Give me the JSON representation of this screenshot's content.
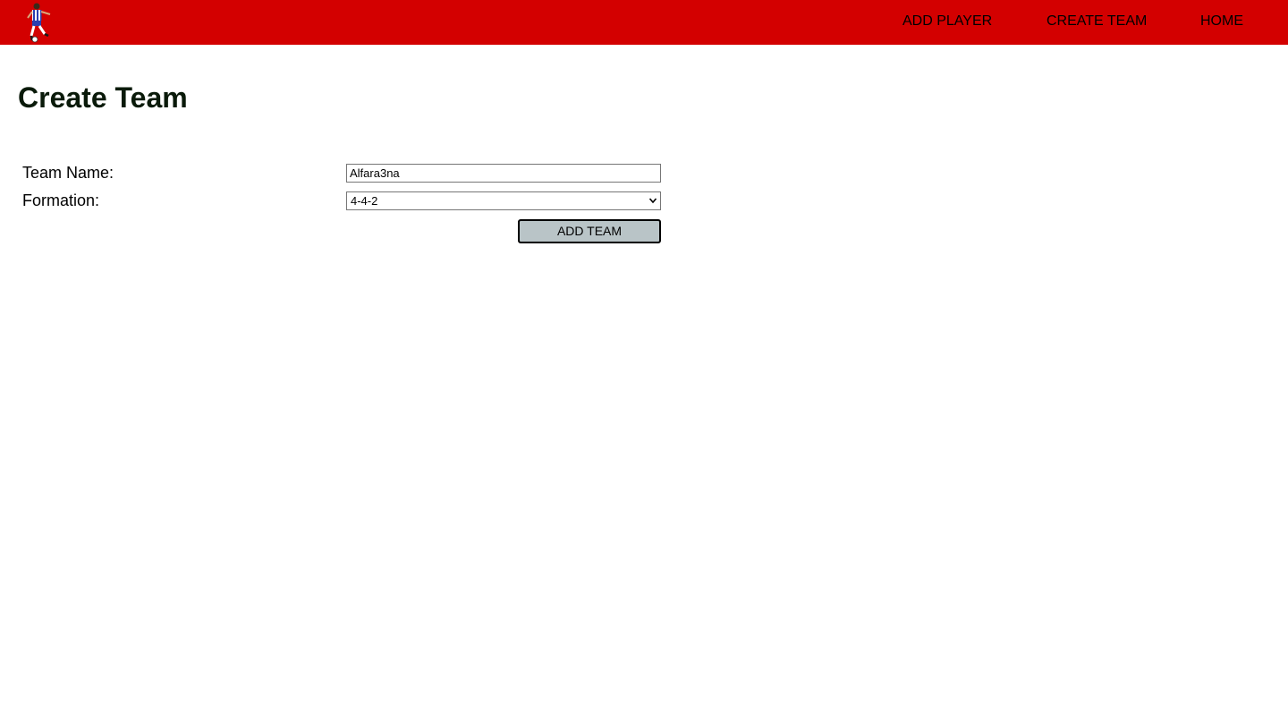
{
  "nav": {
    "logo_icon": "soccer-player-logo-icon",
    "links": [
      "ADD PLAYER",
      "CREATE TEAM",
      "HOME"
    ],
    "background_color": "#d30000"
  },
  "page": {
    "title": "Create Team"
  },
  "form": {
    "team_name_label": "Team Name:",
    "team_name_value": "Alfara3na",
    "formation_label": "Formation:",
    "formation_value": "4-4-2",
    "submit_label": "ADD TEAM"
  }
}
